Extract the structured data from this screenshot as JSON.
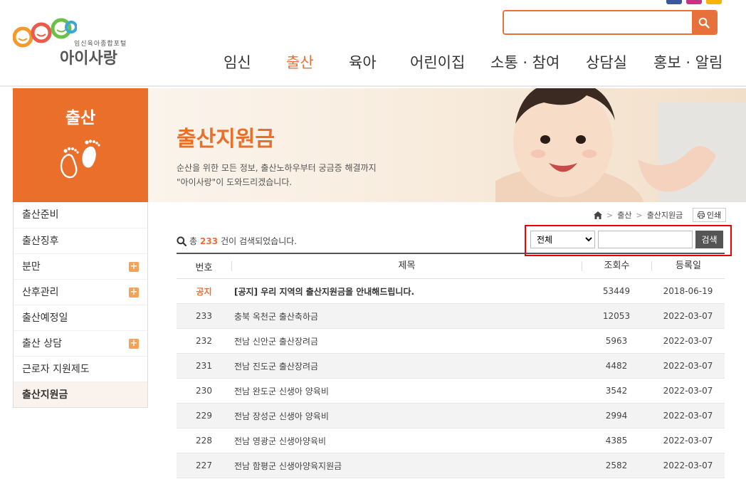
{
  "header": {
    "logo_sub": "임신육아종합포털",
    "logo_main": "아이사랑",
    "search_placeholder": "",
    "nav": [
      "임신",
      "출산",
      "육아",
      "어린이집",
      "소통 · 참여",
      "상담실",
      "홍보 · 알림"
    ],
    "nav_active_index": 1
  },
  "sidebar": {
    "title": "출산",
    "items": [
      {
        "label": "출산준비",
        "has_plus": false
      },
      {
        "label": "출산징후",
        "has_plus": false
      },
      {
        "label": "분만",
        "has_plus": true
      },
      {
        "label": "산후관리",
        "has_plus": true
      },
      {
        "label": "출산예정일",
        "has_plus": false
      },
      {
        "label": "출산 상담",
        "has_plus": true
      },
      {
        "label": "근로자 지원제도",
        "has_plus": false
      },
      {
        "label": "출산지원금",
        "has_plus": false
      }
    ],
    "plus_symbol": "+"
  },
  "banner": {
    "title": "출산지원금",
    "desc_line1": "순산을 위한 모든 정보, 출산노하우부터 궁금증 해결까지",
    "desc_line2": "\"아이사랑\"이 도와드리겠습니다."
  },
  "breadcrumb": {
    "items": [
      "출산",
      "출산지원금"
    ],
    "separator": ">",
    "print_label": "인쇄"
  },
  "list": {
    "count_prefix": "총",
    "count": "233",
    "count_suffix": "건이 검색되었습니다.",
    "filter_selected": "전체",
    "filter_button": "검색",
    "columns": {
      "no": "번호",
      "title": "제목",
      "views": "조회수",
      "date": "등록일"
    },
    "rows": [
      {
        "no": "공지",
        "title": "[공지] 우리 지역의 출산지원금을 안내해드립니다.",
        "views": "53449",
        "date": "2018-06-19",
        "notice": true
      },
      {
        "no": "233",
        "title": "충북 옥천군 출산축하금",
        "views": "12053",
        "date": "2022-03-07"
      },
      {
        "no": "232",
        "title": "전남 신안군 출산장려금",
        "views": "5963",
        "date": "2022-03-07"
      },
      {
        "no": "231",
        "title": "전남 진도군 출산장려금",
        "views": "4482",
        "date": "2022-03-07"
      },
      {
        "no": "230",
        "title": "전남 완도군 신생아 양육비",
        "views": "3542",
        "date": "2022-03-07"
      },
      {
        "no": "229",
        "title": "전남 장성군 신생아 양육비",
        "views": "2994",
        "date": "2022-03-07"
      },
      {
        "no": "228",
        "title": "전남 영광군 신생아양육비",
        "views": "4385",
        "date": "2022-03-07"
      },
      {
        "no": "227",
        "title": "전남 함평군 신생아양육지원금",
        "views": "2582",
        "date": "2022-03-07"
      }
    ]
  },
  "colors": {
    "accent": "#e8703a",
    "sidebar_head": "#ea6f2a",
    "highlight_border": "#e00000"
  }
}
